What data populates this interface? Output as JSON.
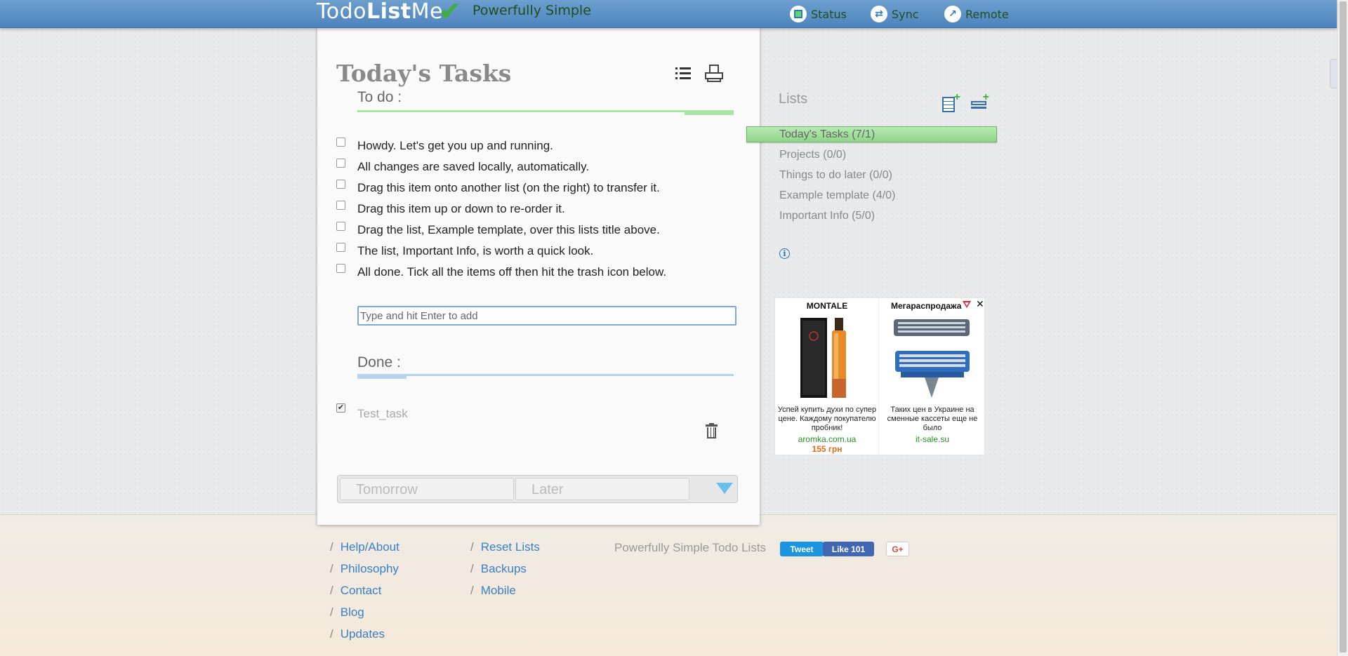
{
  "header": {
    "logo_part1": "Todo",
    "logo_part2": "List",
    "logo_part3": "Me",
    "tagline": "Powerfully Simple",
    "nav": [
      {
        "label": "Status",
        "icon": "status-icon"
      },
      {
        "label": "Sync",
        "icon": "sync-icon"
      },
      {
        "label": "Remote",
        "icon": "remote-icon"
      }
    ]
  },
  "card": {
    "title": "Today's Tasks",
    "todo_label": "To do :",
    "items": [
      "Howdy. Let's get you up and running.",
      "All changes are saved locally, automatically.",
      "Drag this item onto another list (on the right) to transfer it.",
      "Drag this item up or down to re-order it.",
      "Drag the list, Example template, over this lists title above.",
      "The list, Important Info, is worth a quick look.",
      "All done. Tick all the items off then hit the trash icon below."
    ],
    "add_placeholder": "Type and hit Enter to add",
    "done_label": "Done :",
    "done_items": [
      "Test_task"
    ],
    "done_mark": "✔",
    "tabs": {
      "tomorrow": "Tomorrow",
      "later": "Later"
    }
  },
  "lists_panel": {
    "title": "Lists",
    "lists": [
      {
        "label": "Today's Tasks (7/1)",
        "active": true
      },
      {
        "label": "Projects (0/0)",
        "active": false
      },
      {
        "label": "Things to do later (0/0)",
        "active": false
      },
      {
        "label": "Example template (4/0)",
        "active": false
      },
      {
        "label": "Important Info (5/0)",
        "active": false
      }
    ],
    "info_icon": "i"
  },
  "ad": {
    "left": {
      "brand": "MONTALE",
      "desc": "Успей купить духи по супер цене. Каждому покупателю пробник!",
      "link": "aromka.com.ua",
      "price": "155 грн"
    },
    "right": {
      "brand": "Мегараспродажа",
      "desc": "Таких цен в Украине на сменные кассеты еще не было",
      "link": "it-sale.su"
    },
    "close": "✕"
  },
  "footer": {
    "col1": [
      "Help/About",
      "Philosophy",
      "Contact",
      "Blog",
      "Updates"
    ],
    "col2": [
      "Reset Lists",
      "Backups",
      "Mobile"
    ],
    "separator": "/",
    "tagline": "Powerfully Simple Todo Lists",
    "tweet": "Tweet",
    "like": "Like 101",
    "gplus": "G+"
  },
  "colors": {
    "topbar": "#5a90c6",
    "todo_accent": "#a8e3a8",
    "done_accent": "#b6d4ee",
    "link": "#3a7fc4"
  }
}
